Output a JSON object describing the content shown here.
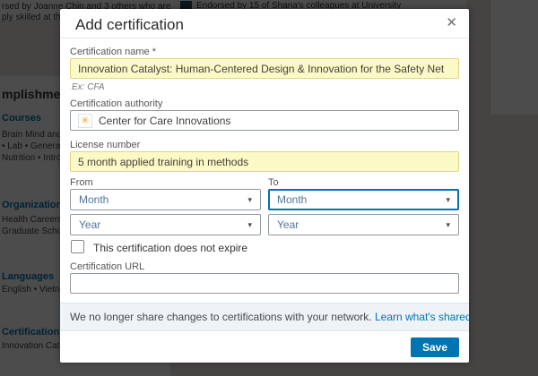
{
  "colors": {
    "accent": "#0073b1",
    "highlight_yellow": "#fbf9c6",
    "note_bg": "#eef3f8",
    "overlay": "rgba(0,0,0,0.70)"
  },
  "icons": {
    "close": "✕",
    "caret": "▾",
    "authority_logo": "✳"
  },
  "background": {
    "top_line1": "rsed by Joanne Chin and 3 others who are",
    "top_line2": "ply skilled at this",
    "endorsement": "Endorsed by 15 of Shana's colleagues at University",
    "left_heading_partial": "mplishments",
    "groups": [
      {
        "title": "Courses",
        "lines": [
          "Brain Mind and B",
          "• Lab  • Genera",
          "Nutrition • Intro"
        ]
      },
      {
        "title": "Organizations",
        "lines": [
          "Health Careers C",
          "Graduate Schoo"
        ]
      },
      {
        "title": "Languages",
        "lines": [
          "English • Vietna"
        ]
      },
      {
        "title": "Certification",
        "lines": [
          "Innovation Catal"
        ]
      }
    ]
  },
  "modal": {
    "title": "Add certification",
    "fields": {
      "name": {
        "label": "Certification name",
        "required": "*",
        "value": "Innovation Catalyst: Human-Centered Design & Innovation for the Safety Net",
        "helper": "Ex: CFA"
      },
      "authority": {
        "label": "Certification authority",
        "value": "Center for Care Innovations"
      },
      "license": {
        "label": "License number",
        "value": "5 month applied training in methods"
      },
      "from": {
        "label": "From",
        "month": "Month",
        "year": "Year"
      },
      "to": {
        "label": "To",
        "month": "Month",
        "year": "Year"
      },
      "expires": {
        "label": "This certification does not expire",
        "checked": false
      },
      "url": {
        "label": "Certification URL",
        "value": ""
      }
    },
    "note": {
      "text": "We no longer share changes to certifications with your network.",
      "link_label": "Learn what's shared"
    },
    "footer": {
      "save_label": "Save"
    }
  }
}
